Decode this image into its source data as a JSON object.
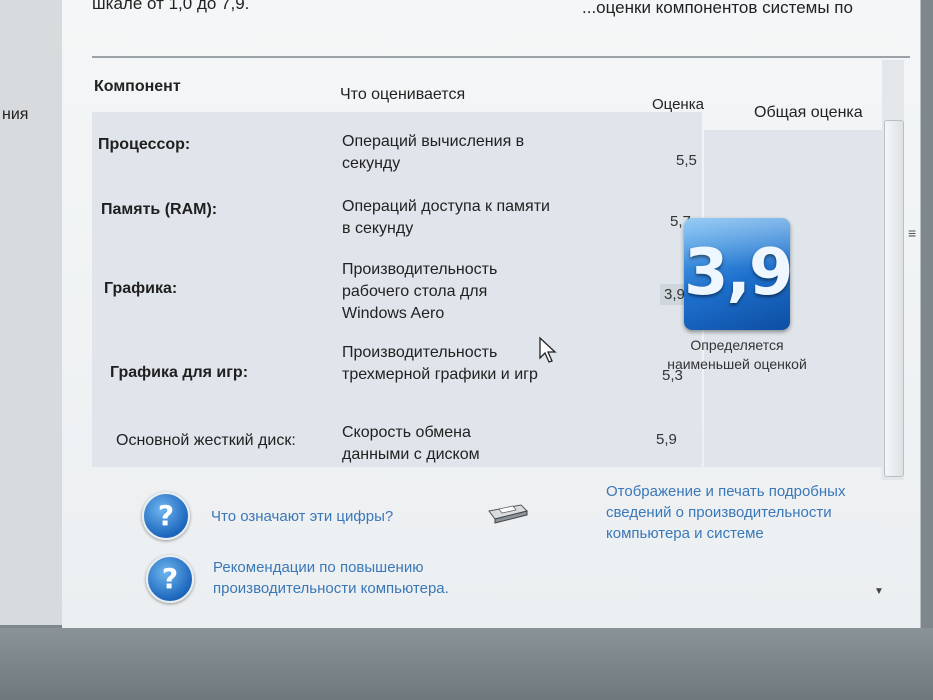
{
  "left_pane": {
    "label": "ния"
  },
  "intro": {
    "left": "шкале от 1,0 до 7,9.",
    "right": "...оценки компонентов системы по"
  },
  "headers": {
    "component": "Компонент",
    "what": "Что оценивается",
    "score": "Оценка",
    "total": "Общая оценка"
  },
  "rows": [
    {
      "component": "Процессор:",
      "desc": "Операций вычисления в секунду",
      "score": "5,5"
    },
    {
      "component": "Память (RAM):",
      "desc": "Операций доступа к памяти в секунду",
      "score": "5,7"
    },
    {
      "component": "Графика:",
      "desc": "Производительность рабочего стола для Windows Aero",
      "score": "3,9"
    },
    {
      "component": "Графика для игр:",
      "desc": "Производительность трехмерной графики и игр",
      "score": "5,3"
    },
    {
      "component": "Основной жесткий диск:",
      "desc": "Скорость обмена данными с диском",
      "score": "5,9"
    }
  ],
  "base_score": {
    "value": "3,9",
    "note": "Определяется наименьшей оценкой"
  },
  "links": {
    "what_numbers": "Что означают эти цифры?",
    "recommendations": "Рекомендации по повышению производительности компьютера.",
    "print_details": "Отображение и печать подробных сведений о производительности компьютера и системе"
  },
  "icons": {
    "help": "help-question-icon",
    "printer": "printer-icon",
    "cursor": "mouse-cursor-icon",
    "grip": "scrollbar-grip-icon"
  },
  "colors": {
    "link": "#3a78b8",
    "table_bg": "#dfe5ea",
    "badge": "#1d6fcc"
  }
}
